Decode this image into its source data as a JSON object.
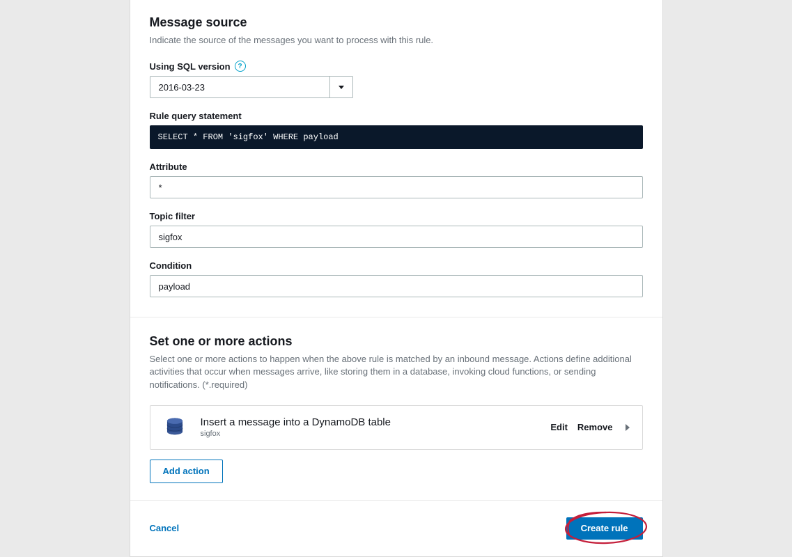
{
  "messageSource": {
    "title": "Message source",
    "description": "Indicate the source of the messages you want to process with this rule.",
    "sqlVersion": {
      "label": "Using SQL version",
      "value": "2016-03-23"
    },
    "queryStatement": {
      "label": "Rule query statement",
      "code": "SELECT * FROM 'sigfox' WHERE payload"
    },
    "attribute": {
      "label": "Attribute",
      "value": "*"
    },
    "topicFilter": {
      "label": "Topic filter",
      "value": "sigfox"
    },
    "condition": {
      "label": "Condition",
      "value": "payload"
    }
  },
  "actions": {
    "title": "Set one or more actions",
    "description": "Select one or more actions to happen when the above rule is matched by an inbound message. Actions define additional activities that occur when messages arrive, like storing them in a database, invoking cloud functions, or sending notifications. (*.required)",
    "items": [
      {
        "title": "Insert a message into a DynamoDB table",
        "subtitle": "sigfox"
      }
    ],
    "editLabel": "Edit",
    "removeLabel": "Remove",
    "addActionLabel": "Add action"
  },
  "footer": {
    "cancelLabel": "Cancel",
    "createLabel": "Create rule"
  }
}
